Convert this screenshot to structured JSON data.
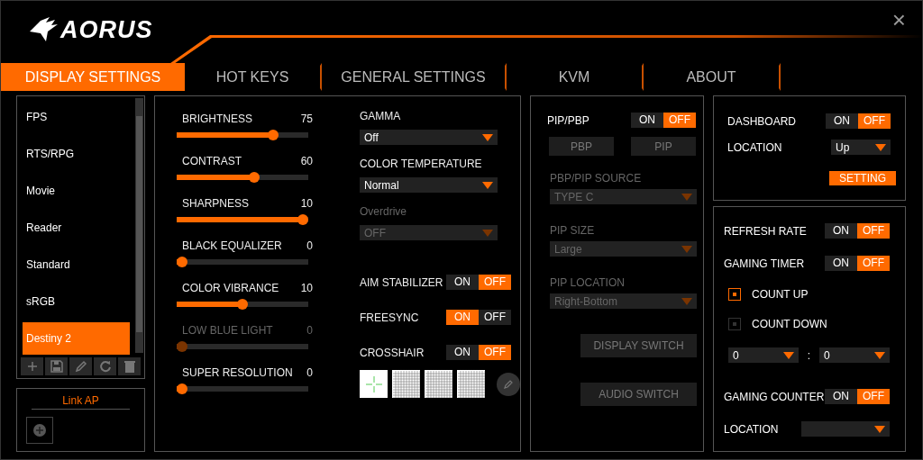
{
  "header": {
    "logo": "AORUS",
    "close": "×"
  },
  "tabs": [
    {
      "label": "DISPLAY SETTINGS",
      "selected": true
    },
    {
      "label": "HOT KEYS",
      "selected": false
    },
    {
      "label": "GENERAL SETTINGS",
      "selected": false
    },
    {
      "label": "KVM",
      "selected": false
    },
    {
      "label": "ABOUT",
      "selected": false
    }
  ],
  "presets": [
    {
      "label": "FPS",
      "selected": false
    },
    {
      "label": "RTS/RPG",
      "selected": false
    },
    {
      "label": "Movie",
      "selected": false
    },
    {
      "label": "Reader",
      "selected": false
    },
    {
      "label": "Standard",
      "selected": false
    },
    {
      "label": "sRGB",
      "selected": false
    },
    {
      "label": "Destiny 2",
      "selected": true
    }
  ],
  "link_ap": {
    "title": "Link AP"
  },
  "sliders": [
    {
      "label": "BRIGHTNESS",
      "reading": "75",
      "level": 0.75,
      "disabled": false
    },
    {
      "label": "CONTRAST",
      "reading": "60",
      "level": 0.6,
      "disabled": false
    },
    {
      "label": "SHARPNESS",
      "reading": "10",
      "level": 1,
      "disabled": false
    },
    {
      "label": "BLACK EQUALIZER",
      "reading": "0",
      "level": 0,
      "disabled": false
    },
    {
      "label": "COLOR VIBRANCE",
      "reading": "10",
      "level": 0.5,
      "disabled": false
    },
    {
      "label": "LOW BLUE LIGHT",
      "reading": "0",
      "level": 0,
      "disabled": true
    },
    {
      "label": "SUPER RESOLUTION",
      "reading": "0",
      "level": 0,
      "disabled": false
    }
  ],
  "dropdowns": [
    {
      "label": "GAMMA",
      "value": "Off",
      "disabled": false
    },
    {
      "label": "COLOR TEMPERATURE",
      "value": "Normal",
      "disabled": false
    },
    {
      "label": "Overdrive",
      "value": "OFF",
      "disabled": true
    }
  ],
  "toggles": [
    {
      "label": "AIM STABILIZER",
      "on": false,
      "on_text": "ON",
      "off_text": "OFF"
    },
    {
      "label": "FREESYNC",
      "on": true,
      "on_text": "ON",
      "off_text": "OFF"
    },
    {
      "label": "CROSSHAIR",
      "on": false,
      "on_text": "ON",
      "off_text": "OFF"
    }
  ],
  "crosshairs": [
    {
      "kind": "cross"
    },
    {
      "kind": "grid"
    },
    {
      "kind": "grid"
    },
    {
      "kind": "grid"
    }
  ],
  "pip": {
    "toggle": {
      "label": "PIP/PBP",
      "on": false,
      "on_text": "ON",
      "off_text": "OFF"
    },
    "modes": [
      "PBP",
      "PIP"
    ],
    "dropdowns": [
      {
        "label": "PBP/PIP SOURCE",
        "value": "TYPE C",
        "disabled": true
      },
      {
        "label": "PIP SIZE",
        "value": "Large",
        "disabled": true
      },
      {
        "label": "PIP LOCATION",
        "value": "Right-Bottom",
        "disabled": true
      }
    ],
    "buttons": [
      "DISPLAY SWITCH",
      "AUDIO SWITCH"
    ]
  },
  "dashboard": {
    "toggle": {
      "label": "DASHBOARD",
      "on": false,
      "on_text": "ON",
      "off_text": "OFF"
    },
    "location": {
      "label": "LOCATION",
      "value": "Up"
    },
    "button": "SETTING"
  },
  "gaming": {
    "refresh_rate": {
      "label": "REFRESH RATE",
      "on": false,
      "on_text": "ON",
      "off_text": "OFF"
    },
    "timer": {
      "label": "GAMING TIMER",
      "on": false,
      "on_text": "ON",
      "off_text": "OFF"
    },
    "modes": [
      {
        "label": "COUNT UP",
        "selected": true
      },
      {
        "label": "COUNT DOWN",
        "selected": false
      }
    ],
    "time": [
      {
        "value": "0"
      },
      {
        "value": "0"
      }
    ],
    "separator": ":",
    "counter": {
      "label": "GAMING COUNTER",
      "on": false,
      "on_text": "ON",
      "off_text": "OFF"
    },
    "location": {
      "label": "LOCATION"
    }
  }
}
